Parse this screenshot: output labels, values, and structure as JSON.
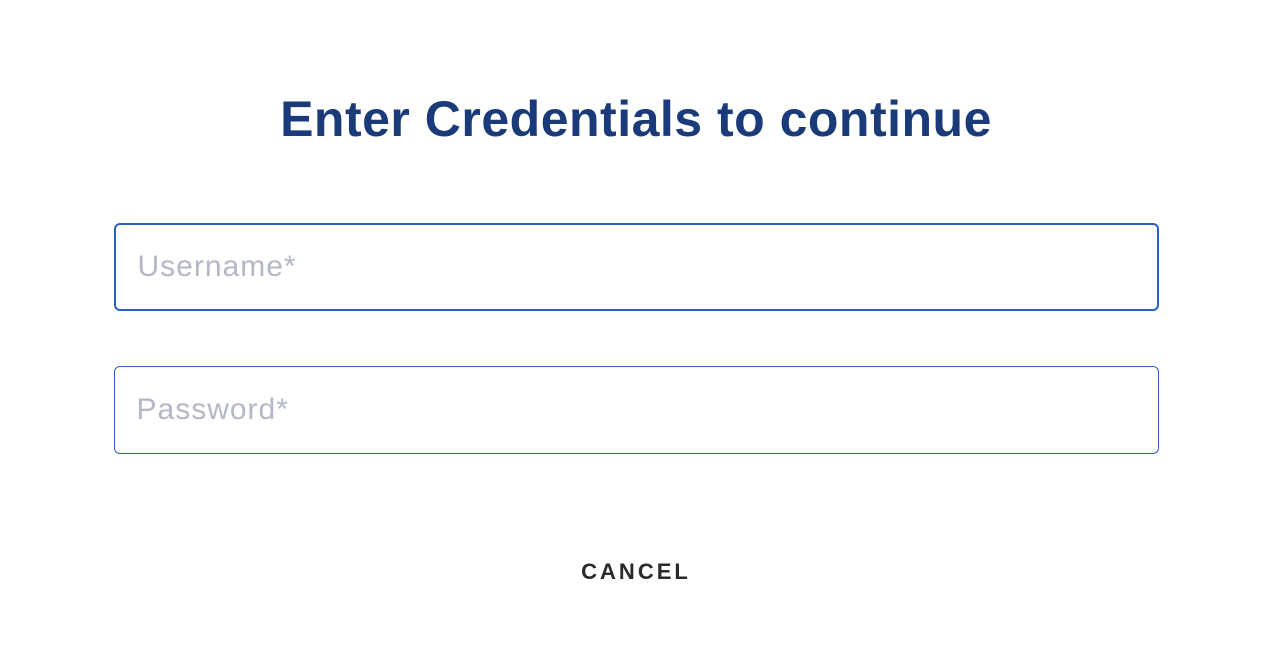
{
  "heading": "Enter Credentials to continue",
  "fields": {
    "username": {
      "placeholder": "Username*",
      "value": ""
    },
    "password": {
      "placeholder": "Password*",
      "value": ""
    }
  },
  "buttons": {
    "cancel_label": "CANCEL"
  }
}
